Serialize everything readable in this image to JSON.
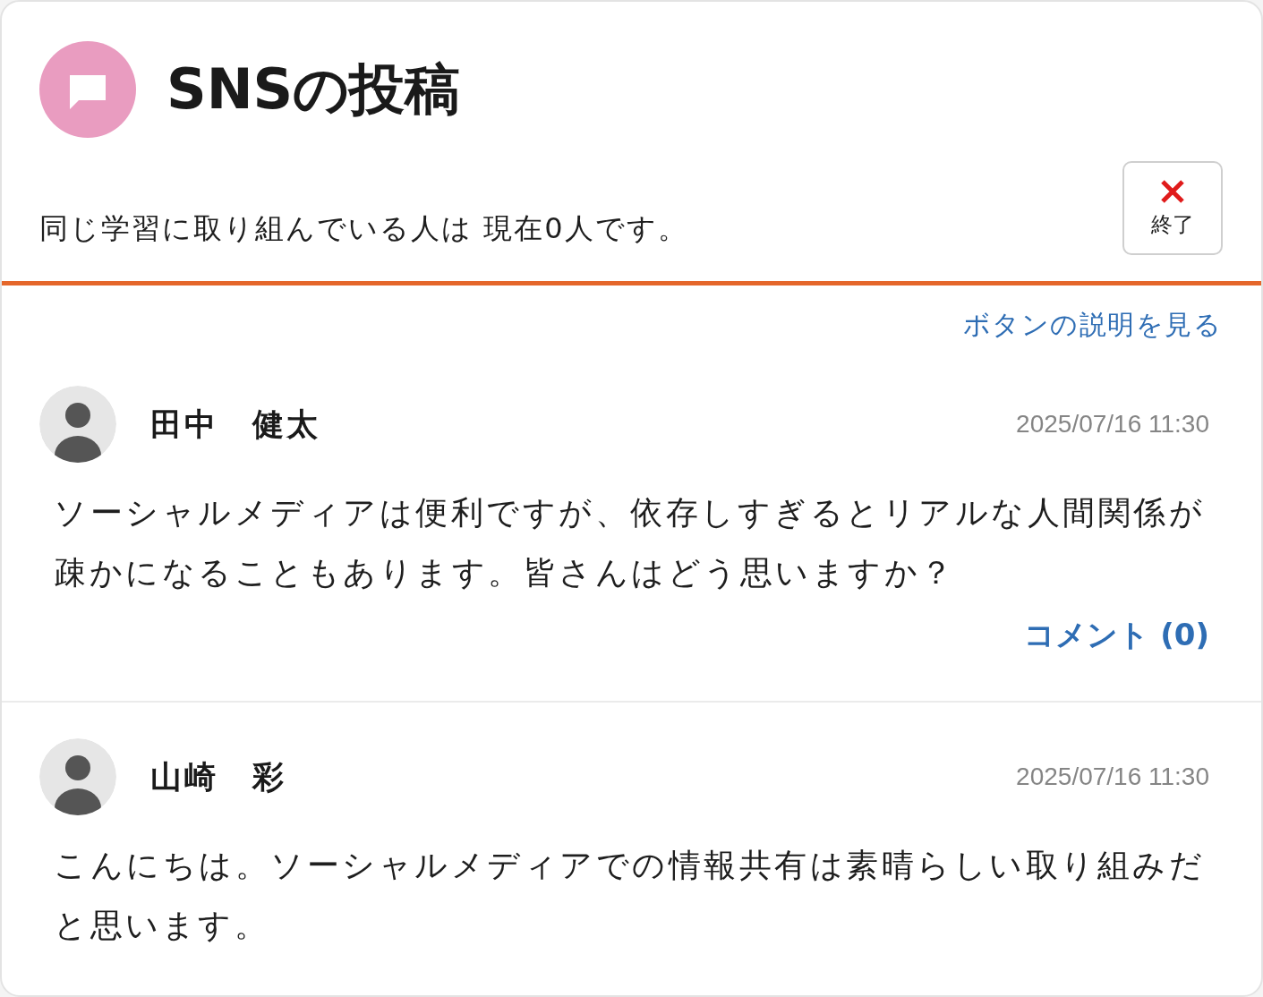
{
  "header": {
    "title": "SNSの投稿",
    "subtitle": "同じ学習に取り組んでいる人は 現在0人です。",
    "close_button": {
      "label": "終了"
    }
  },
  "help_link": "ボタンの説明を見る",
  "posts": [
    {
      "author": "田中　健太",
      "timestamp": "2025/07/16 11:30",
      "body": "ソーシャルメディアは便利ですが、依存しすぎるとリアルな人間関係が疎かになることもあります。皆さんはどう思いますか？",
      "comment_link": "コメント (0)"
    },
    {
      "author": "山崎　彩",
      "timestamp": "2025/07/16 11:30",
      "body": "こんにちは。ソーシャルメディアでの情報共有は素晴らしい取り組みだと思います。"
    }
  ]
}
